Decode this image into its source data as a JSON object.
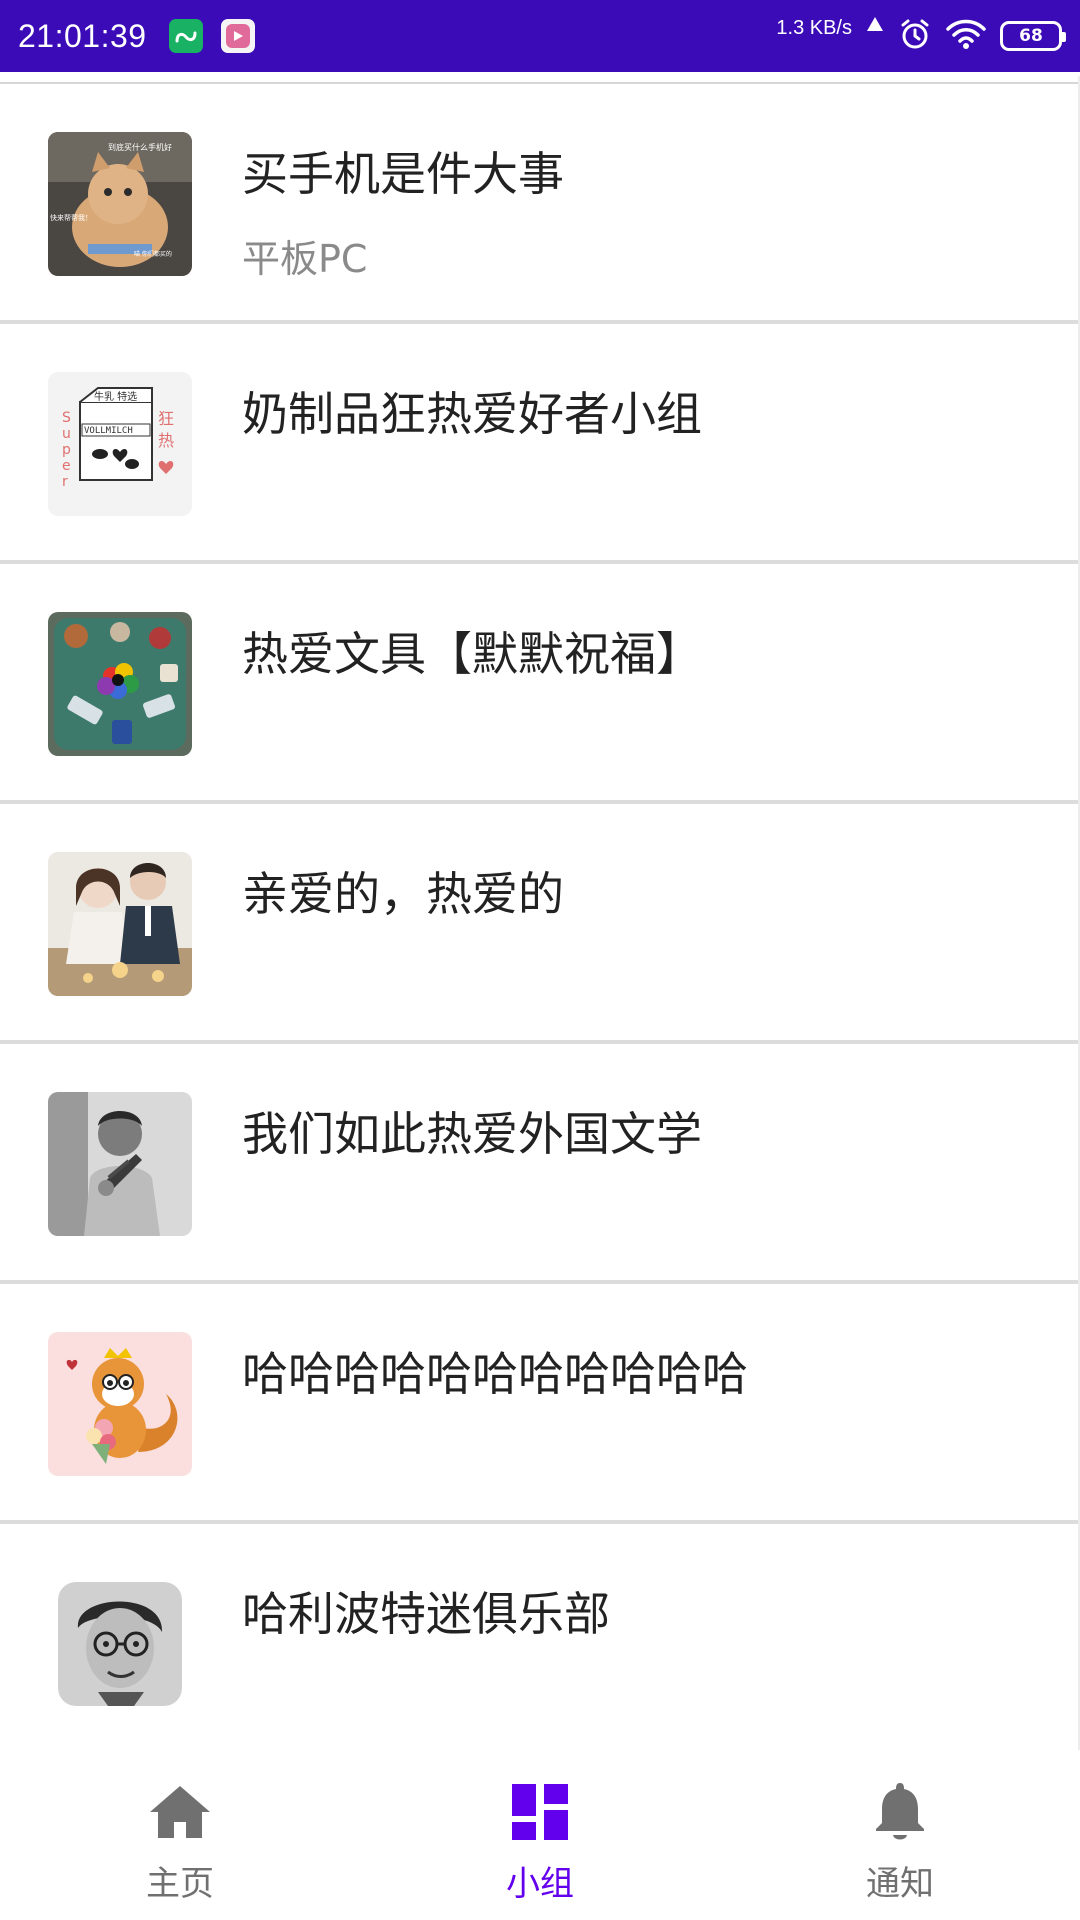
{
  "status_bar": {
    "time": "21:01:39",
    "net_speed": "1.3 KB/s",
    "battery": "68",
    "background": "#3b0bb8"
  },
  "groups": [
    {
      "name": "买手机是件大事",
      "category": "平板PC",
      "thumb": "cat-photo"
    },
    {
      "name": "奶制品狂热爱好者小组",
      "category": "",
      "thumb": "milk-carton"
    },
    {
      "name": "热爱文具【默默祝福】",
      "category": "",
      "thumb": "stationery-photo"
    },
    {
      "name": "亲爱的，热爱的",
      "category": "",
      "thumb": "drama-poster"
    },
    {
      "name": "我们如此热爱外国文学",
      "category": "",
      "thumb": "author-photo"
    },
    {
      "name": "哈哈哈哈哈哈哈哈哈哈哈",
      "category": "",
      "thumb": "squirrel-cartoon"
    },
    {
      "name": "哈利波特迷俱乐部",
      "category": "",
      "thumb": "harry-potter-sketch"
    }
  ],
  "bottom_nav": {
    "items": [
      {
        "label": "主页",
        "icon": "home-icon",
        "active": false
      },
      {
        "label": "小组",
        "icon": "dashboard-icon",
        "active": true
      },
      {
        "label": "通知",
        "icon": "bell-icon",
        "active": false
      }
    ],
    "active_color": "#6200ee",
    "inactive_color": "#707070"
  }
}
